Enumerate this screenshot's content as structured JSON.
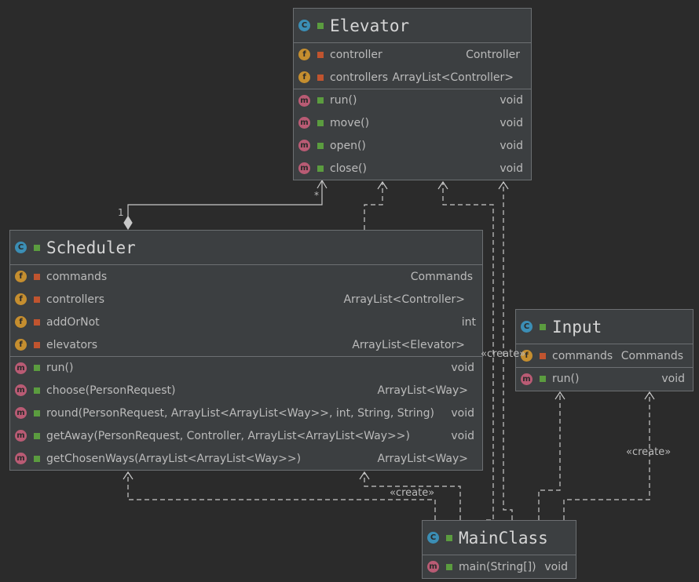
{
  "classes": {
    "elevator": {
      "name": "Elevator",
      "fields": [
        {
          "name": "controller",
          "type": "Controller"
        },
        {
          "name": "controllers",
          "type": "ArrayList<Controller>"
        }
      ],
      "methods": [
        {
          "name": "run()",
          "type": "void"
        },
        {
          "name": "move()",
          "type": "void"
        },
        {
          "name": "open()",
          "type": "void"
        },
        {
          "name": "close()",
          "type": "void"
        }
      ]
    },
    "scheduler": {
      "name": "Scheduler",
      "fields": [
        {
          "name": "commands",
          "type": "Commands"
        },
        {
          "name": "controllers",
          "type": "ArrayList<Controller>"
        },
        {
          "name": "addOrNot",
          "type": "int"
        },
        {
          "name": "elevators",
          "type": "ArrayList<Elevator>"
        }
      ],
      "methods": [
        {
          "name": "run()",
          "type": "void"
        },
        {
          "name": "choose(PersonRequest)",
          "type": "ArrayList<Way>"
        },
        {
          "name": "round(PersonRequest, ArrayList<ArrayList<Way>>, int, String, String)",
          "type": "void"
        },
        {
          "name": "getAway(PersonRequest, Controller, ArrayList<ArrayList<Way>>)",
          "type": "void"
        },
        {
          "name": "getChosenWays(ArrayList<ArrayList<Way>>)",
          "type": "ArrayList<Way>"
        }
      ]
    },
    "input": {
      "name": "Input",
      "fields": [
        {
          "name": "commands",
          "type": "Commands"
        }
      ],
      "methods": [
        {
          "name": "run()",
          "type": "void"
        }
      ]
    },
    "mainclass": {
      "name": "MainClass",
      "methods": [
        {
          "name": "main(String[])",
          "type": "void"
        }
      ]
    }
  },
  "labels": {
    "create_1": "«create»",
    "create_2": "«create»",
    "create_3": "«create»",
    "mult_one": "1",
    "mult_many": "*"
  },
  "icons": {
    "class": "C",
    "field": "f",
    "method": "m"
  },
  "colors": {
    "background": "#2b2b2b",
    "box": "#3c3f41",
    "class_icon": "#3b8eb5",
    "field_icon": "#c58e2f",
    "method_icon": "#b95b74",
    "public_lock": "#5b9c3f",
    "private_lock": "#c0542f"
  }
}
